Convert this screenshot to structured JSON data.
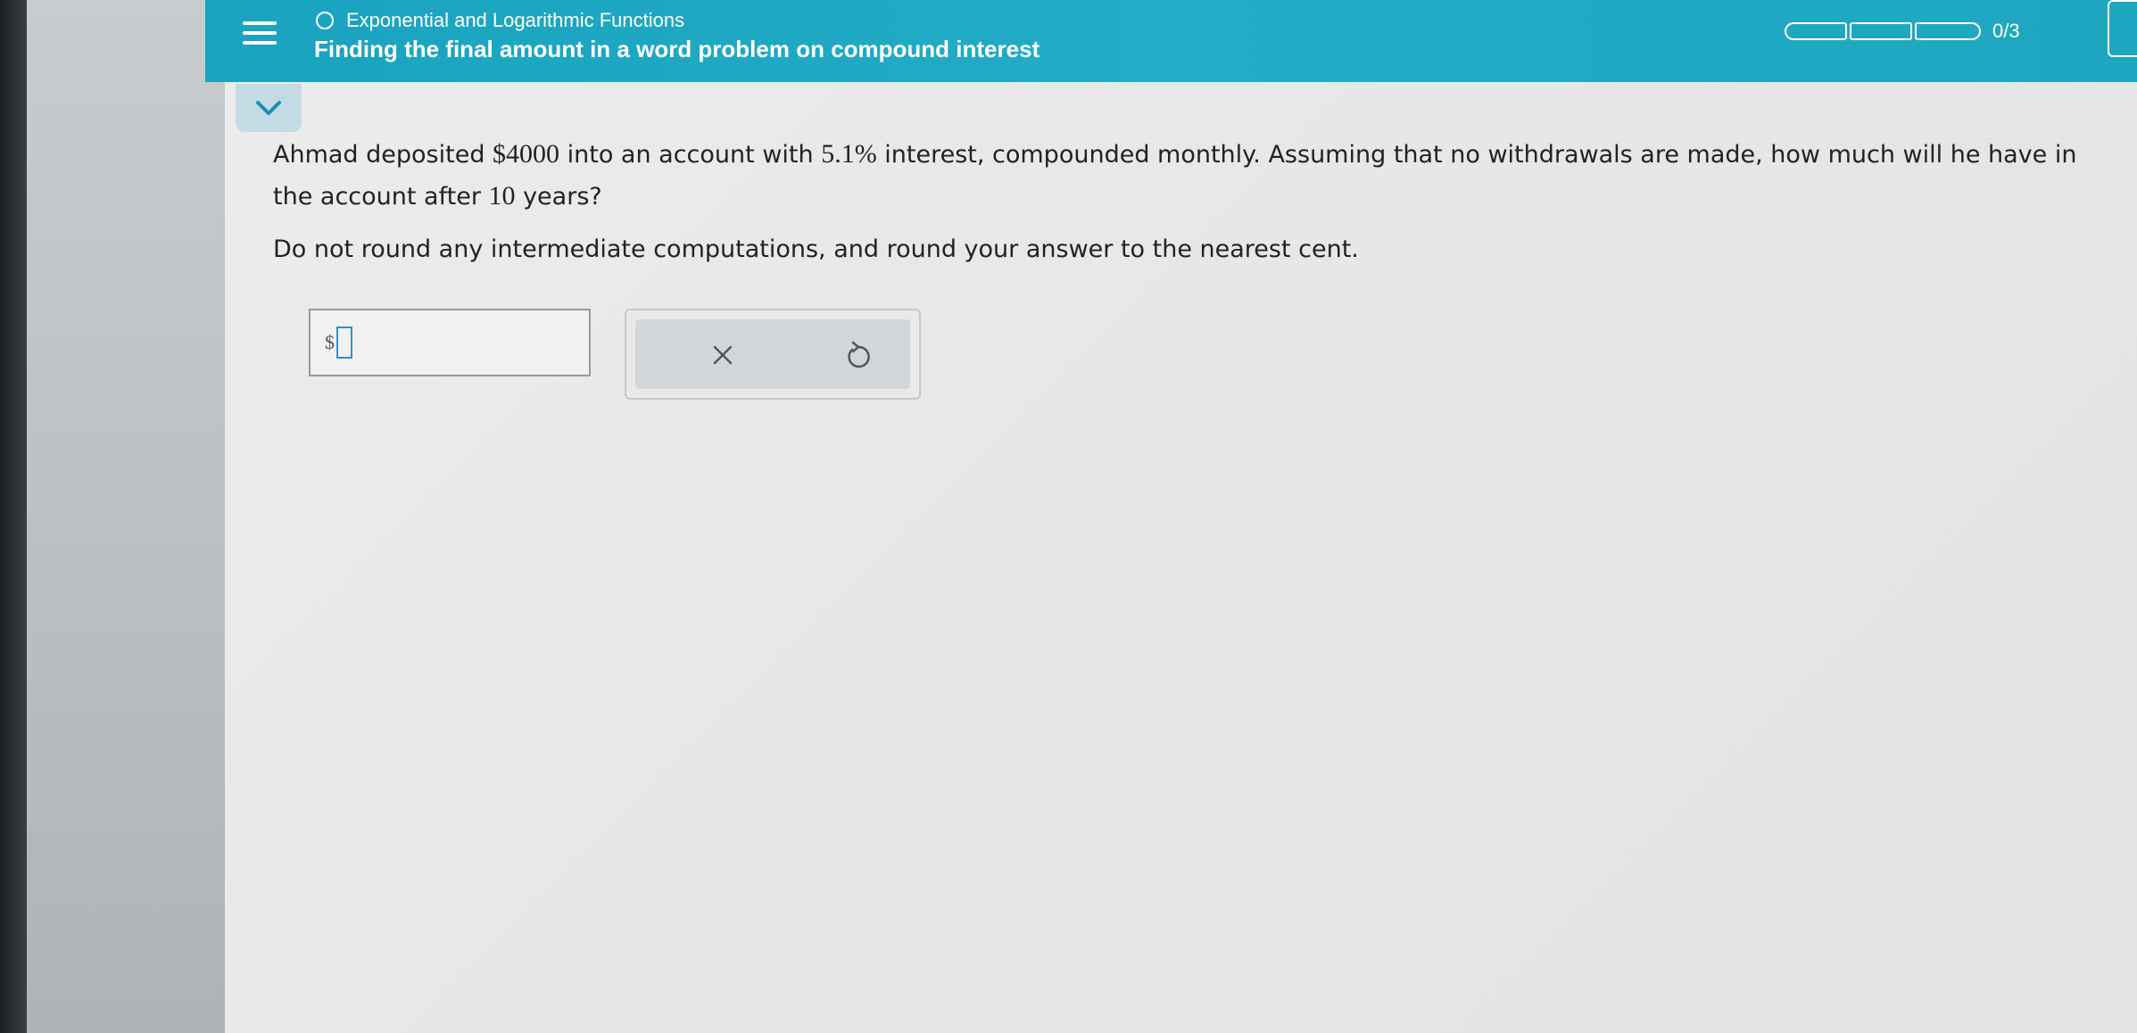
{
  "header": {
    "topic": "Exponential and Logarithmic Functions",
    "title": "Finding the final amount in a word problem on compound interest",
    "progress": "0/3",
    "progress_segments": 3,
    "progress_filled": 0
  },
  "question": {
    "part1": "Ahmad deposited ",
    "amount": "$4000",
    "part2": " into an account with ",
    "rate": "5.1%",
    "part3": " interest, compounded monthly. Assuming that no withdrawals are made, how much will he have in the account after ",
    "years": "10",
    "part4": " years?",
    "instruction": "Do not round any intermediate computations, and round your answer to the nearest cent."
  },
  "answer": {
    "prefix": "$",
    "value": ""
  },
  "icons": {
    "menu": "hamburger-menu-icon",
    "topic": "circle-outline-icon",
    "collapse": "chevron-down-icon",
    "clear": "close-icon",
    "undo": "undo-icon"
  },
  "colors": {
    "header": "#1fa6c1",
    "collapse_tab": "#c4dbe3",
    "input_cursor": "#3a8fc1"
  }
}
